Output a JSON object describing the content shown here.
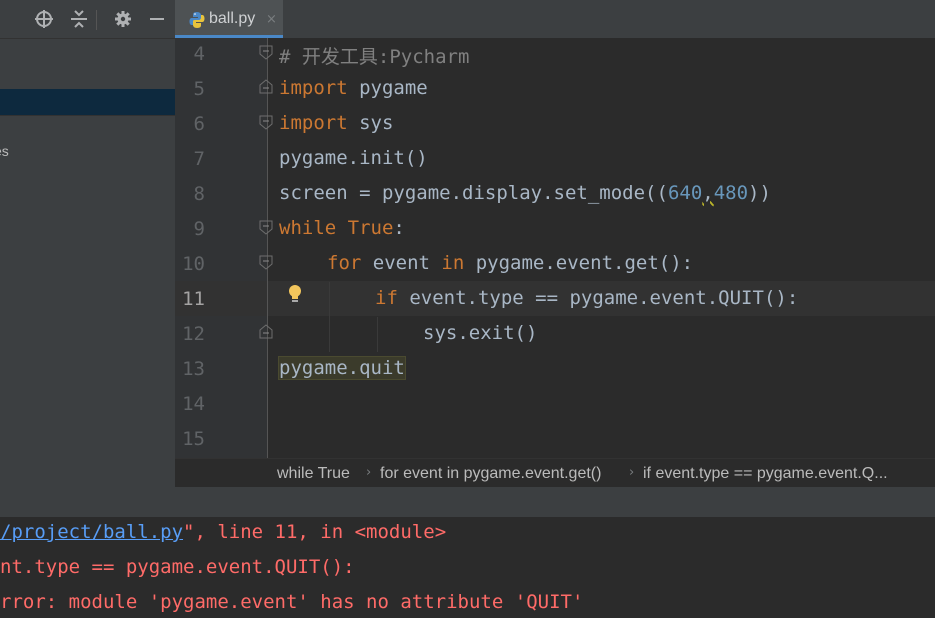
{
  "toolbar": {
    "icons": [
      "locate-icon",
      "collapse-icon",
      "gear-icon",
      "minimize-icon"
    ]
  },
  "project_tree": {
    "partial_item": "es"
  },
  "tab": {
    "label": "ball.py",
    "close": "×"
  },
  "editor": {
    "line_numbers": [
      "4",
      "5",
      "6",
      "7",
      "8",
      "9",
      "10",
      "11",
      "12",
      "13",
      "14",
      "15"
    ],
    "current_line": "11",
    "lines": {
      "l4": "# 开发工具:Pycharm",
      "l5_kw": "import",
      "l5_rest": " pygame",
      "l6_kw": "import",
      "l6_rest": " sys",
      "l7": "pygame.init()",
      "l8_a": "screen = pygame.display.set_mode((",
      "l8_n1": "640",
      "l8_comma": ",",
      "l8_n2": "480",
      "l8_b": "))",
      "l9_kw": "while",
      "l9_true": " True",
      "l9_rest": ":",
      "l10_kw": "for",
      "l10_a": " event ",
      "l10_in": "in",
      "l10_b": " pygame.event.get():",
      "l11_kw": "if",
      "l11_rest": " event.type == pygame.event.QUIT():",
      "l12": "sys.exit()",
      "l13": "pygame.quit"
    }
  },
  "breadcrumb": {
    "items": [
      "while True",
      "for event in pygame.event.get()",
      "if event.type == pygame.event.Q..."
    ]
  },
  "console": {
    "line1_link": "/project/ball.py",
    "line1_rest": "\", line 11, in <module>",
    "line2": "nt.type == pygame.event.QUIT():",
    "line3": "rror: module 'pygame.event' has no attribute 'QUIT'"
  },
  "colors": {
    "keyword": "#cc7832",
    "comment": "#808080",
    "number": "#6897bb",
    "error": "#ff6b68",
    "link": "#589df6",
    "selection": "#0d293e"
  }
}
